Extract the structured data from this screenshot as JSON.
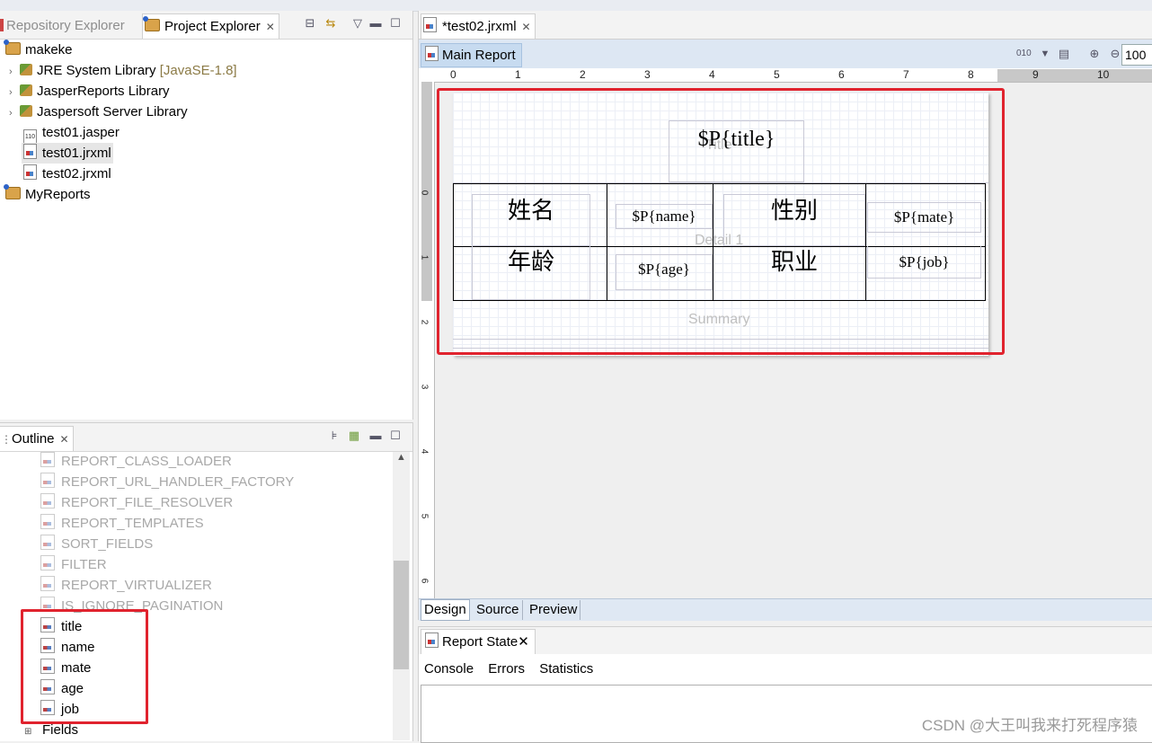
{
  "explorer": {
    "tabs": {
      "repository": "Repository Explorer",
      "project": "Project Explorer"
    },
    "tree": {
      "root": "makeke",
      "jre_label": "JRE System Library",
      "jre_version": "[JavaSE-1.8]",
      "jasperreports": "JasperReports Library",
      "jaspersoft_server": "Jaspersoft Server Library",
      "file1": "test01.jasper",
      "file2": "test01.jrxml",
      "file3": "test02.jrxml",
      "root2": "MyReports"
    }
  },
  "outline": {
    "tab": "Outline",
    "builtin_params": [
      "REPORT_CLASS_LOADER",
      "REPORT_URL_HANDLER_FACTORY",
      "REPORT_FILE_RESOLVER",
      "REPORT_TEMPLATES",
      "SORT_FIELDS",
      "FILTER",
      "REPORT_VIRTUALIZER",
      "IS_IGNORE_PAGINATION"
    ],
    "custom_params": [
      "title",
      "name",
      "mate",
      "age",
      "job"
    ],
    "fields_label": "Fields"
  },
  "editor": {
    "tab": "*test02.jrxml",
    "subtab": "Main Report",
    "zoom": "100",
    "ruler_h": [
      "0",
      "1",
      "2",
      "3",
      "4",
      "5",
      "6",
      "7",
      "8",
      "9",
      "10"
    ],
    "ruler_v": [
      "0",
      "1",
      "2",
      "3",
      "4",
      "5",
      "6"
    ],
    "bands": {
      "title": "Title",
      "detail": "Detail 1",
      "summary": "Summary"
    },
    "title_field": "$P{title}",
    "table": {
      "label_name": "姓名",
      "field_name": "$P{name}",
      "label_gender": "性别",
      "field_gender": "$P{mate}",
      "label_age": "年龄",
      "field_age": "$P{age}",
      "label_job": "职业",
      "field_job": "$P{job}"
    },
    "bottom_tabs": [
      "Design",
      "Source",
      "Preview"
    ]
  },
  "report_state": {
    "tab": "Report State",
    "subtabs": [
      "Console",
      "Errors",
      "Statistics"
    ]
  },
  "watermark": "CSDN @大王叫我来打死程序猿",
  "colors": {
    "highlight": "#e0232e",
    "accent": "#c7dbf0"
  }
}
